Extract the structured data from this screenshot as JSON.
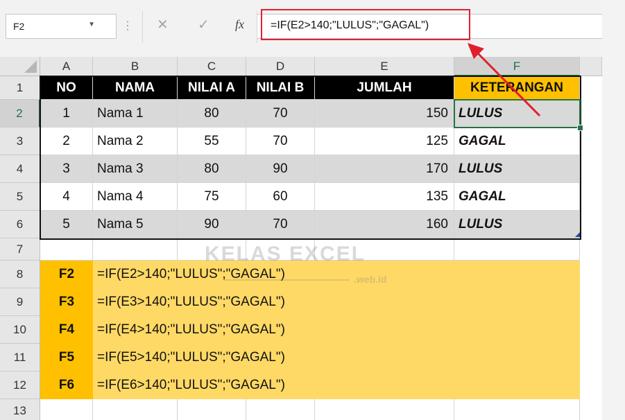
{
  "formula_bar": {
    "name_box": "F2",
    "dropdown_glyph": "▼",
    "dots_glyph": "⋮",
    "cancel_glyph": "✕",
    "enter_glyph": "✓",
    "fx_glyph": "fx",
    "formula": "=IF(E2>140;\"LULUS\";\"GAGAL\")"
  },
  "columns": [
    "A",
    "B",
    "C",
    "D",
    "E",
    "F"
  ],
  "rows_labels": [
    "1",
    "2",
    "3",
    "4",
    "5",
    "6",
    "7",
    "8",
    "9",
    "10",
    "11",
    "12",
    "13"
  ],
  "header": {
    "no": "NO",
    "nama": "NAMA",
    "nilai_a": "NILAI A",
    "nilai_b": "NILAI B",
    "jumlah": "JUMLAH",
    "keterangan": "KETERANGAN"
  },
  "data_rows": [
    {
      "no": "1",
      "nama": "Nama 1",
      "a": "80",
      "b": "70",
      "jumlah": "150",
      "ket": "LULUS"
    },
    {
      "no": "2",
      "nama": "Nama 2",
      "a": "55",
      "b": "70",
      "jumlah": "125",
      "ket": "GAGAL"
    },
    {
      "no": "3",
      "nama": "Nama 3",
      "a": "80",
      "b": "90",
      "jumlah": "170",
      "ket": "LULUS"
    },
    {
      "no": "4",
      "nama": "Nama 4",
      "a": "75",
      "b": "60",
      "jumlah": "135",
      "ket": "GAGAL"
    },
    {
      "no": "5",
      "nama": "Nama 5",
      "a": "90",
      "b": "70",
      "jumlah": "160",
      "ket": "LULUS"
    }
  ],
  "formulas": [
    {
      "cell": "F2",
      "formula": "=IF(E2>140;\"LULUS\";\"GAGAL\")"
    },
    {
      "cell": "F3",
      "formula": "=IF(E3>140;\"LULUS\";\"GAGAL\")"
    },
    {
      "cell": "F4",
      "formula": "=IF(E4>140;\"LULUS\";\"GAGAL\")"
    },
    {
      "cell": "F5",
      "formula": "=IF(E5>140;\"LULUS\";\"GAGAL\")"
    },
    {
      "cell": "F6",
      "formula": "=IF(E6>140;\"LULUS\";\"GAGAL\")"
    }
  ],
  "watermark": {
    "main": "KELAS EXCEL",
    "sub": ".web.id"
  },
  "colors": {
    "header_bg": "#000000",
    "keterangan_bg": "#ffc000",
    "stripe": "#d9d9d9",
    "formula_bg": "#ffd966",
    "highlight": "#e0202e",
    "selection": "#217346"
  },
  "icons": [
    "dropdown-icon",
    "cancel-icon",
    "enter-icon",
    "fx-icon",
    "arrow-annotation"
  ]
}
